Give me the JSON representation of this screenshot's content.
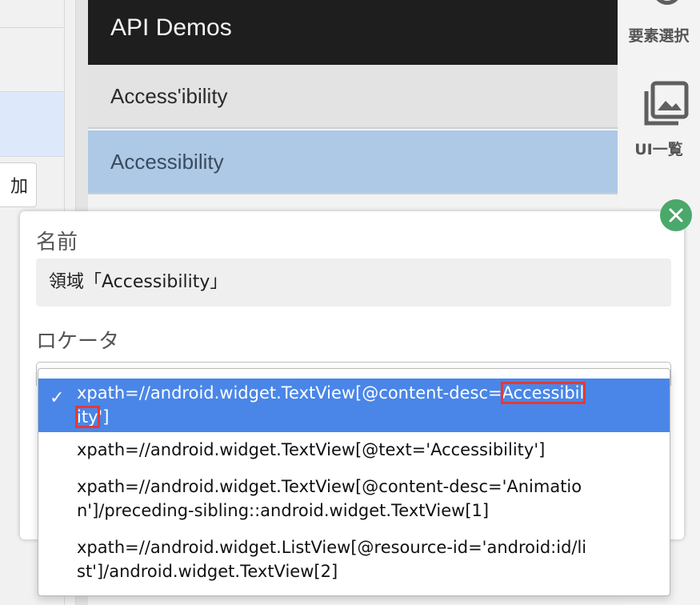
{
  "app": {
    "title": "API Demos"
  },
  "left": {
    "button_label": "加"
  },
  "list": {
    "items": [
      {
        "label": "Access'ibility"
      },
      {
        "label": "Accessibility",
        "selected": true
      }
    ]
  },
  "toolbar": {
    "items": [
      {
        "label": "要素選択",
        "icon": "pin-icon"
      },
      {
        "label": "UI一覧",
        "icon": "gallery-icon"
      }
    ]
  },
  "dialog": {
    "name_label": "名前",
    "name_value": "領域「Accessibility」",
    "locator_label": "ロケータ",
    "close_icon": "close-icon"
  },
  "locators": {
    "options": [
      {
        "pre": "xpath=//android.widget.TextView[@content-desc=",
        "mark1": "Accessibil",
        "mark2": "ity",
        "post": "']",
        "selected": true
      },
      {
        "text": "xpath=//android.widget.TextView[@text='Accessibility']"
      },
      {
        "line1": "xpath=//android.widget.TextView[@content-desc='Animatio",
        "line2": "n']/preceding-sibling::android.widget.TextView[1]"
      },
      {
        "line1": "xpath=//android.widget.ListView[@resource-id='android:id/li",
        "line2": "st']/android.widget.TextView[2]"
      }
    ]
  },
  "colors": {
    "selected_option": "#4a86e8",
    "highlight_box": "#e53935",
    "close_button": "#4aa86a",
    "selected_row": "#aec9e6"
  }
}
